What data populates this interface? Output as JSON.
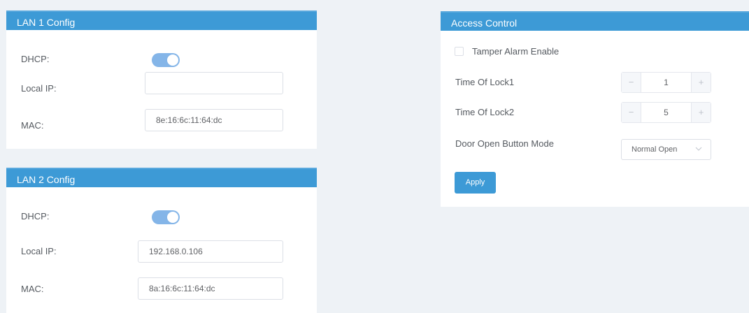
{
  "lan1": {
    "title": "LAN 1 Config",
    "dhcp_label": "DHCP:",
    "dhcp_enabled": true,
    "local_ip_label": "Local IP:",
    "local_ip_value": "",
    "mac_label": "MAC:",
    "mac_value": "8e:16:6c:11:64:dc"
  },
  "lan2": {
    "title": "LAN 2 Config",
    "dhcp_label": "DHCP:",
    "dhcp_enabled": true,
    "local_ip_label": "Local IP:",
    "local_ip_value": "192.168.0.106",
    "mac_label": "MAC:",
    "mac_value": "8a:16:6c:11:64:dc"
  },
  "access": {
    "title": "Access Control",
    "tamper_label": "Tamper Alarm Enable",
    "tamper_checked": false,
    "lock1_label": "Time Of Lock1",
    "lock1_value": "1",
    "lock2_label": "Time Of Lock2",
    "lock2_value": "5",
    "stepper_minus": "−",
    "stepper_plus": "+",
    "door_mode_label": "Door Open Button Mode",
    "door_mode_value": "Normal Open",
    "apply_label": "Apply"
  },
  "colors": {
    "header": "#3d9ad6",
    "toggle_on": "#84b5e8",
    "background": "#eef2f6"
  },
  "icons": {
    "select_chevron": "chevron-down-icon"
  }
}
